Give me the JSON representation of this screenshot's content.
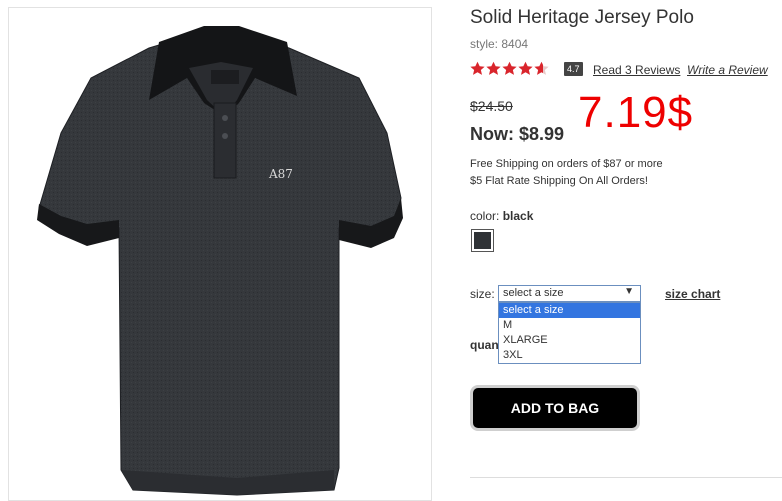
{
  "product": {
    "title": "Solid Heritage Jersey Polo",
    "style": "style: 8404",
    "rating_value": "4.7",
    "star_count": 5,
    "rating_fraction": 0.94,
    "read_reviews": "Read 3 Reviews",
    "write_review": "Write a Review",
    "was_price": "$24.50",
    "now_price": "Now: $8.99",
    "overlay_price": "7.19$",
    "shipping_line1": "Free Shipping on orders of $87 or more",
    "shipping_line2": "$5 Flat Rate Shipping On All Orders!",
    "color_label": "color:",
    "color_value": "black",
    "swatch_color": "#2f3236"
  },
  "size": {
    "label": "size:",
    "selected": "select a size",
    "options": [
      "select a size",
      "M",
      "XLARGE",
      "3XL"
    ],
    "chart_link": "size chart"
  },
  "quantity": {
    "label": "quan"
  },
  "cart": {
    "button_label": "ADD TO BAG"
  },
  "colors": {
    "accent_red": "#ee0000",
    "star_red": "#d9252c",
    "shirt": "#2f3236"
  },
  "image": {
    "alt": "A87"
  }
}
